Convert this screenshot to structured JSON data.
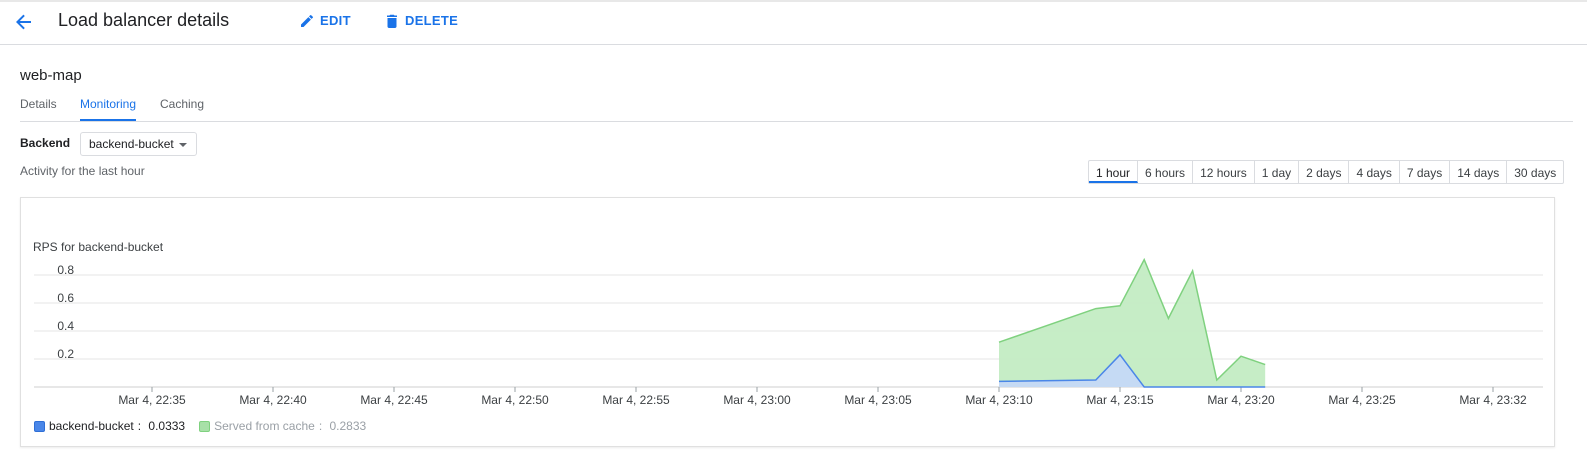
{
  "header": {
    "title": "Load balancer details",
    "edit_label": "EDIT",
    "delete_label": "DELETE"
  },
  "resource_name": "web-map",
  "tabs": [
    {
      "label": "Details",
      "active": false
    },
    {
      "label": "Monitoring",
      "active": true
    },
    {
      "label": "Caching",
      "active": false
    }
  ],
  "backend": {
    "label": "Backend",
    "selected": "backend-bucket"
  },
  "activity_text": "Activity for the last hour",
  "time_ranges": [
    "1 hour",
    "6 hours",
    "12 hours",
    "1 day",
    "2 days",
    "4 days",
    "7 days",
    "14 days",
    "30 days"
  ],
  "active_range": "1 hour",
  "colors": {
    "accent": "#1a73e8",
    "series_blue": "#4a86e8",
    "series_blue_fill": "#c5d9f7",
    "series_green": "#7fd17f",
    "series_green_fill": "#c3ecc3"
  },
  "chart_data": {
    "type": "area",
    "title": "RPS for backend-bucket",
    "xlabel": "",
    "ylabel": "",
    "x_ticks": [
      "Mar 4, 22:35",
      "Mar 4, 22:40",
      "Mar 4, 22:45",
      "Mar 4, 22:50",
      "Mar 4, 22:55",
      "Mar 4, 23:00",
      "Mar 4, 23:05",
      "Mar 4, 23:10",
      "Mar 4, 23:15",
      "Mar 4, 23:20",
      "Mar 4, 23:25",
      "Mar 4, 23:32"
    ],
    "y_ticks": [
      "0.2",
      "0.4",
      "0.6",
      "0.8"
    ],
    "ylim": [
      0,
      0.8
    ],
    "grid": true,
    "legend_position": "bottom-left",
    "series": [
      {
        "name": "backend-bucket",
        "legend_value": "0.0333",
        "x": [
          "23:10",
          "23:14",
          "23:15",
          "23:16",
          "23:21"
        ],
        "values": [
          0.04,
          0.05,
          0.23,
          0.0,
          0.0
        ]
      },
      {
        "name": "Served from cache",
        "legend_value": "0.2833",
        "x": [
          "23:10",
          "23:14",
          "23:15",
          "23:16",
          "23:17",
          "23:18",
          "23:19",
          "23:20",
          "23:21"
        ],
        "values": [
          0.32,
          0.56,
          0.58,
          0.91,
          0.49,
          0.83,
          0.05,
          0.22,
          0.16
        ]
      }
    ]
  }
}
